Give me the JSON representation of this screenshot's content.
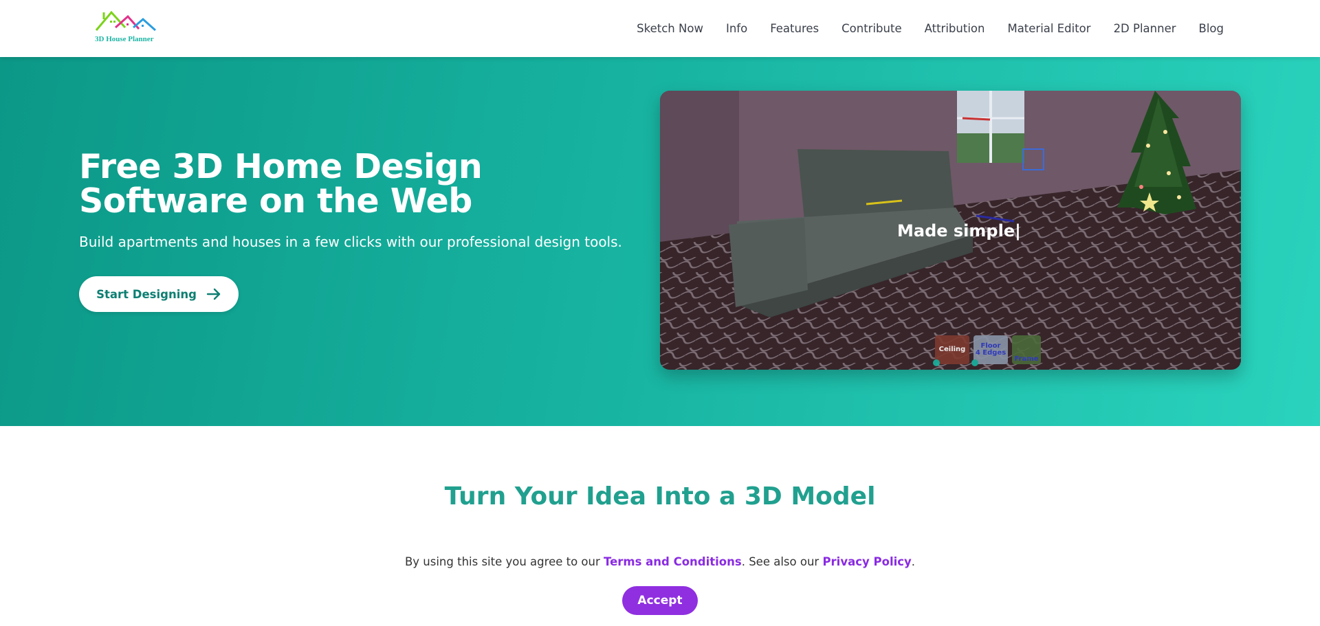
{
  "logo": {
    "text": "3D House Planner"
  },
  "nav": [
    {
      "label": "Sketch Now"
    },
    {
      "label": "Info"
    },
    {
      "label": "Features"
    },
    {
      "label": "Contribute"
    },
    {
      "label": "Attribution"
    },
    {
      "label": "Material Editor"
    },
    {
      "label": "2D Planner"
    },
    {
      "label": "Blog"
    }
  ],
  "hero": {
    "title": "Free 3D Home Design Software on the Web",
    "subtitle": "Build apartments and houses in a few clicks with our professional design tools.",
    "cta_label": "Start Designing",
    "preview_caption": "Made simple|",
    "thumbs": [
      {
        "label": "Ceiling"
      },
      {
        "label": "Floor",
        "sub": "4 Edges"
      },
      {
        "label": "Frame"
      }
    ]
  },
  "section": {
    "title": "Turn Your Idea Into a 3D Model"
  },
  "cookie": {
    "prefix": "By using this site you agree to our ",
    "terms_link": "Terms and Conditions",
    "middle": ". See also our ",
    "privacy_link": "Privacy Policy",
    "suffix": ".",
    "accept_label": "Accept"
  },
  "colors": {
    "accent": "#21a08f",
    "hero_start": "#0c9887",
    "hero_end": "#2ad3bd",
    "link_purple": "#8a2be2",
    "accept_bg": "#8f2fe0"
  }
}
